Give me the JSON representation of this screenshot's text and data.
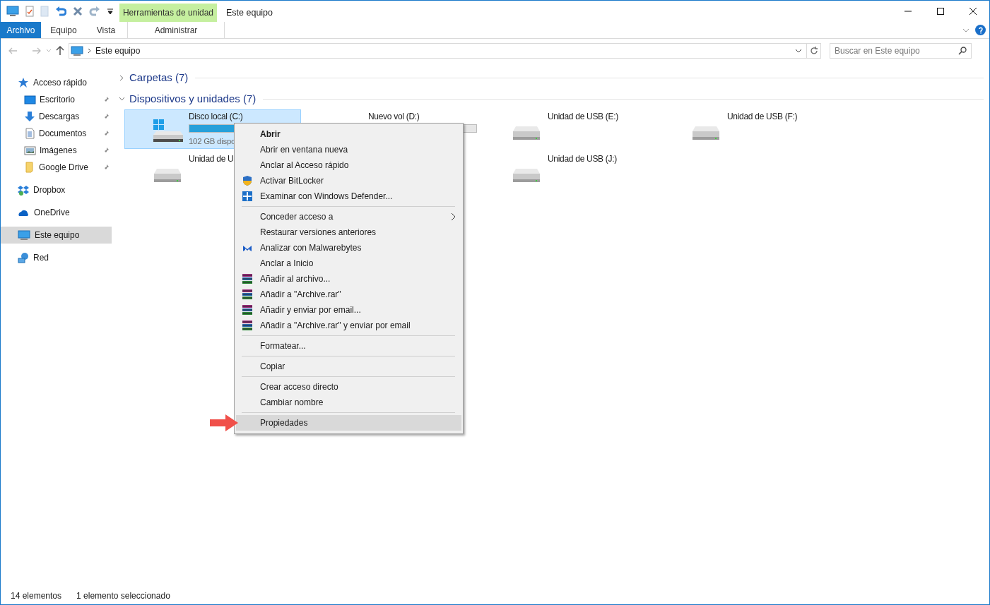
{
  "window": {
    "title": "Este equipo",
    "contextual_tab": "Herramientas de unidad"
  },
  "ribbon_tabs": [
    {
      "label": "Archivo",
      "selected": true
    },
    {
      "label": "Equipo",
      "selected": false
    },
    {
      "label": "Vista",
      "selected": false
    },
    {
      "label": "Administrar",
      "selected": false
    }
  ],
  "address_bar": {
    "path": "Este equipo"
  },
  "search": {
    "placeholder": "Buscar en Este equipo"
  },
  "sidebar": {
    "items": [
      {
        "label": "Acceso rápido",
        "selected": false,
        "children": [
          {
            "label": "Escritorio",
            "selected": false
          },
          {
            "label": "Descargas",
            "selected": false
          },
          {
            "label": "Documentos",
            "selected": false
          },
          {
            "label": "Imágenes",
            "selected": false
          },
          {
            "label": "Google Drive",
            "selected": false
          }
        ]
      },
      {
        "label": "Dropbox",
        "selected": false
      },
      {
        "label": "OneDrive",
        "selected": false
      },
      {
        "label": "Este equipo",
        "selected": true
      },
      {
        "label": "Red",
        "selected": false
      }
    ]
  },
  "sections": [
    {
      "title": "Carpetas (7)",
      "expanded": false
    },
    {
      "title": "Dispositivos y unidades (7)",
      "expanded": true
    }
  ],
  "drives": [
    {
      "name": "Disco local (C:)",
      "kind": "system",
      "selected": true,
      "level": 0.42,
      "free": "102 GB dispo"
    },
    {
      "name": "Nuevo vol (D:)",
      "kind": "volume",
      "selected": false
    },
    {
      "name": "Unidad de USB (E:)",
      "kind": "usb",
      "selected": false
    },
    {
      "name": "Unidad de USB (F:)",
      "kind": "usb",
      "selected": false
    },
    {
      "name": "Unidad de U",
      "kind": "usb",
      "selected": false
    },
    {
      "name": "Unidad de USB (J:)",
      "kind": "usb",
      "selected": false
    }
  ],
  "context_menu": [
    {
      "kind": "item",
      "label": "Abrir",
      "bold": true,
      "selected": false
    },
    {
      "kind": "item",
      "label": "Abrir en ventana nueva",
      "selected": false
    },
    {
      "kind": "item",
      "label": "Anclar al Acceso rápido",
      "selected": false
    },
    {
      "kind": "item",
      "label": "Activar BitLocker",
      "selected": false
    },
    {
      "kind": "item",
      "label": "Examinar con Windows Defender...",
      "selected": false
    },
    {
      "kind": "separator"
    },
    {
      "kind": "item",
      "label": "Conceder acceso a",
      "submenu": true,
      "selected": false
    },
    {
      "kind": "item",
      "label": "Restaurar versiones anteriores",
      "selected": false
    },
    {
      "kind": "item",
      "label": "Analizar con Malwarebytes",
      "selected": false
    },
    {
      "kind": "item",
      "label": "Anclar a Inicio",
      "selected": false
    },
    {
      "kind": "item",
      "label": "Añadir al archivo...",
      "selected": false
    },
    {
      "kind": "item",
      "label": "Añadir a \"Archive.rar\"",
      "selected": false
    },
    {
      "kind": "item",
      "label": "Añadir y enviar por email...",
      "selected": false
    },
    {
      "kind": "item",
      "label": "Añadir a \"Archive.rar\" y enviar por email",
      "selected": false
    },
    {
      "kind": "separator"
    },
    {
      "kind": "item",
      "label": "Formatear...",
      "selected": false
    },
    {
      "kind": "separator"
    },
    {
      "kind": "item",
      "label": "Copiar",
      "selected": false
    },
    {
      "kind": "separator"
    },
    {
      "kind": "item",
      "label": "Crear acceso directo",
      "selected": false
    },
    {
      "kind": "item",
      "label": "Cambiar nombre",
      "selected": false
    },
    {
      "kind": "separator"
    },
    {
      "kind": "item",
      "label": "Propiedades",
      "selected": true,
      "pointer": true
    }
  ],
  "status_bar": {
    "count": "14 elementos",
    "selection": "1 elemento seleccionado"
  }
}
